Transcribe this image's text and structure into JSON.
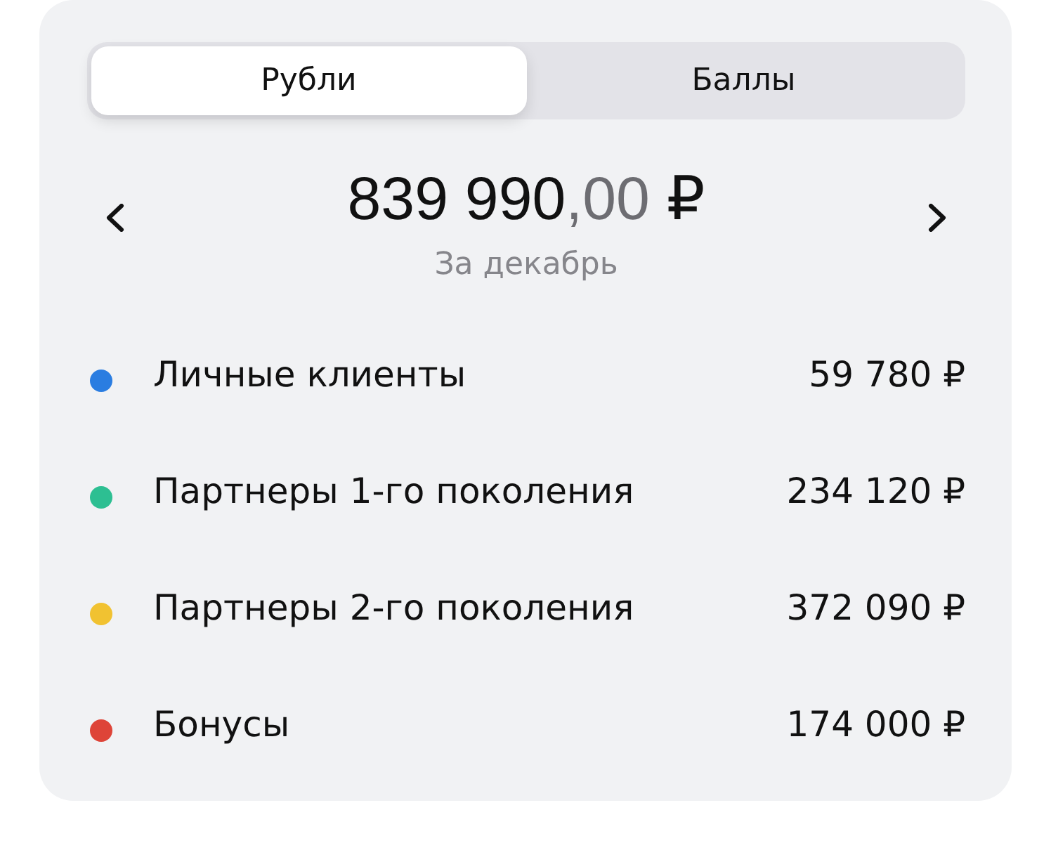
{
  "tabs": [
    {
      "label": "Рубли",
      "selected": true
    },
    {
      "label": "Баллы",
      "selected": false
    }
  ],
  "summary": {
    "total": {
      "integer": "839 990",
      "fraction": ",00",
      "currency": "₽"
    },
    "period": "За декабрь"
  },
  "items": [
    {
      "label": "Личные клиенты",
      "value": "59 780 ₽",
      "color": "#2a7de1"
    },
    {
      "label": "Партнеры 1-го поколения",
      "value": "234 120 ₽",
      "color": "#2dbf92"
    },
    {
      "label": "Партнеры 2-го поколения",
      "value": "372 090 ₽",
      "color": "#f1c231"
    },
    {
      "label": "Бонусы",
      "value": "174 000 ₽",
      "color": "#de4438"
    }
  ]
}
